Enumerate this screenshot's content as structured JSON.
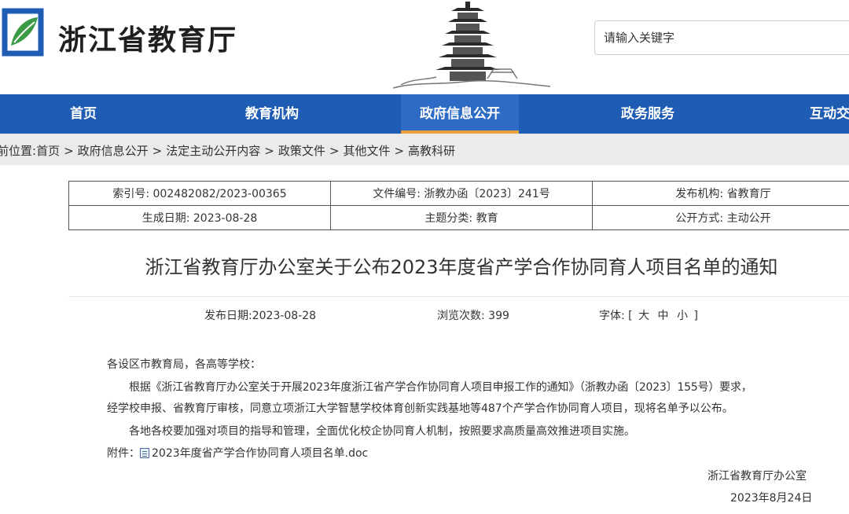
{
  "header": {
    "site_name": "浙江省教育厅",
    "search_placeholder": "请输入关键字",
    "logo_icon": "zhejiang-education-leaf-logo",
    "banner_icon": "pagoda-illustration"
  },
  "nav": {
    "items": [
      {
        "label": "首页"
      },
      {
        "label": "教育机构"
      },
      {
        "label": "政府信息公开"
      },
      {
        "label": "政务服务"
      },
      {
        "label": "互动交"
      }
    ],
    "active_index": 2,
    "colors": {
      "background": "#1f5cb3",
      "active": "#2d6bc4",
      "active_underline": "#e8a33d"
    }
  },
  "breadcrumb": {
    "prefix": "前位置:",
    "items": [
      "首页",
      "政府信息公开",
      "法定主动公开内容",
      "政策文件",
      "其他文件",
      "高教科研"
    ],
    "separator": ">"
  },
  "info": {
    "index_no": "索引号: 002482082/2023-00365",
    "doc_no": "文件编号: 浙教办函〔2023〕241号",
    "issuer": "发布机构: 省教育厅",
    "created_date": "生成日期: 2023-08-28",
    "topic": "主题分类: 教育",
    "disclosure": "公开方式: 主动公开"
  },
  "article": {
    "title": "浙江省教育厅办公室关于公布2023年度省产学合作协同育人项目名单的通知",
    "publish_date": "发布日期:2023-08-28",
    "views": "浏览次数: 399",
    "font_label": "字体:",
    "font_open": "[",
    "font_large": "大",
    "font_medium": "中",
    "font_small": "小",
    "font_close": "]",
    "salutation": "各设区市教育局，各高等学校：",
    "para1_line1": "根据《浙江省教育厅办公室关于开展2023年度浙江省产学合作协同育人项目申报工作的通知》（浙教办函〔2023〕155号）要求，",
    "para1_line2": "经学校申报、省教育厅审核，同意立项浙江大学智慧学校体育创新实践基地等487个产学合作协同育人项目，现将名单予以公布。",
    "para2": "各地各校要加强对项目的指导和管理，全面优化校企协同育人机制，按照要求高质量高效推进项目实施。",
    "attachment_label": "附件：",
    "attachment_name": "2023年度省产学合作协同育人项目名单.doc",
    "attachment_icon": "document-icon",
    "signer": "浙江省教育厅办公室",
    "sign_date": "2023年8月24日"
  }
}
